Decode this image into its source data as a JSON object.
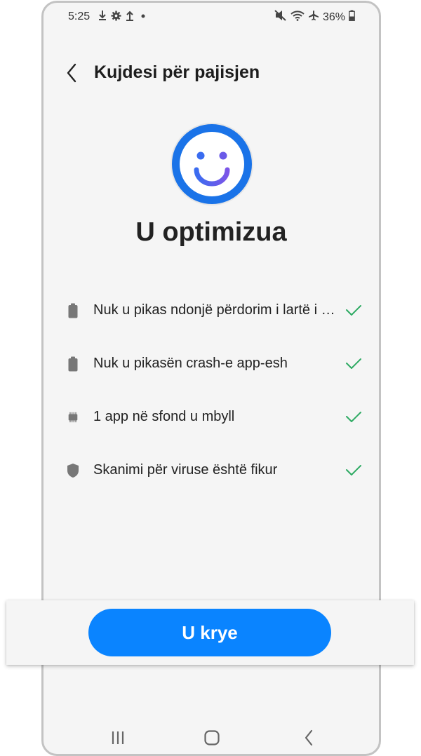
{
  "status_bar": {
    "time": "5:25",
    "battery_percent": "36%",
    "left_icons": [
      "download-icon",
      "gear-icon",
      "upload-icon",
      "dot-icon"
    ],
    "right_icons": [
      "mute-icon",
      "wifi-icon",
      "airplane-icon",
      "battery-icon"
    ]
  },
  "header": {
    "title": "Kujdesi për pajisjen"
  },
  "result": {
    "title": "U optimizua",
    "accent_color": "#1a73e8"
  },
  "checklist": [
    {
      "icon": "battery-icon",
      "label": "Nuk u pikas ndonjë përdorim i lartë i baterisë"
    },
    {
      "icon": "battery-icon",
      "label": "Nuk u pikasën crash-e app-esh"
    },
    {
      "icon": "memory-chip-icon",
      "label": "1 app në sfond u mbyll"
    },
    {
      "icon": "shield-icon",
      "label": "Skanimi për viruse është fikur"
    }
  ],
  "done_button": {
    "label": "U krye",
    "color": "#0a84ff"
  },
  "nav": {
    "items": [
      "recent-apps-icon",
      "home-icon",
      "back-icon"
    ]
  }
}
